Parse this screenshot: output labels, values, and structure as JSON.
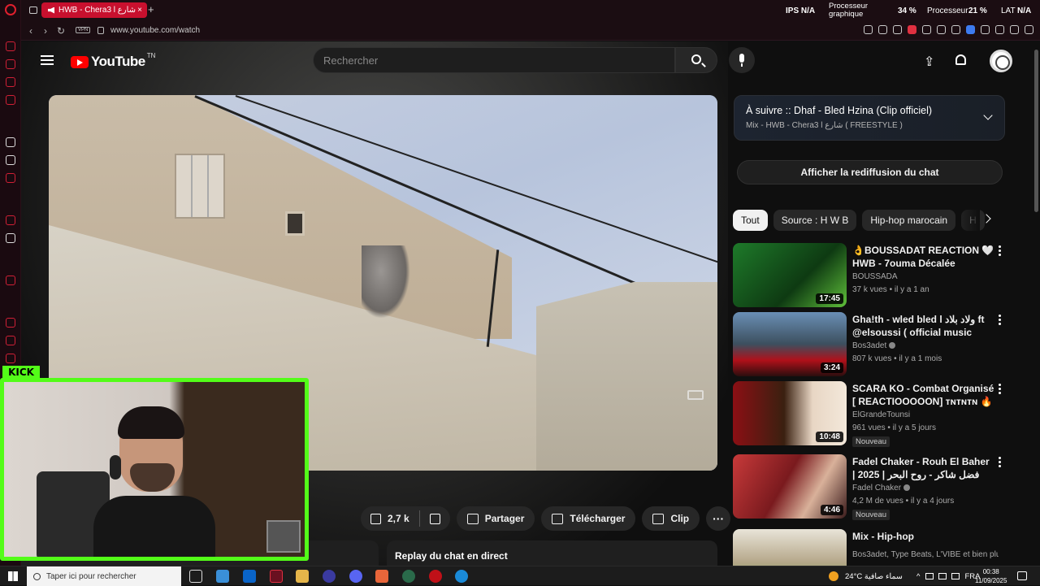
{
  "browser": {
    "tab_title": "HWB - Chera3 l شارع",
    "url": "www.youtube.com/watch",
    "vpn_label": "VPN",
    "hud": {
      "ips_label": "IPS",
      "ips_value": "N/A",
      "gpu_label_line1": "Processeur",
      "gpu_label_line2": "graphique",
      "gpu_value": "34 %",
      "cpu_label": "Processeur",
      "cpu_value": "21 %",
      "lat_label": "LAT",
      "lat_value": "N/A"
    }
  },
  "youtube": {
    "logo_text": "YouTube",
    "logo_country": "TN",
    "search_placeholder": "Rechercher",
    "actions": {
      "likes": "2,7 k",
      "share": "Partager",
      "download": "Télécharger",
      "clip": "Clip",
      "more": "···"
    },
    "replay_chat_label": "Replay du chat en direct",
    "up_next": {
      "title": "À suivre :: Dhaf - Bled Hzina (Clip officiel)",
      "subtitle": "Mix - HWB - Chera3 l شارع ( FREESTYLE )"
    },
    "show_chat_replay": "Afficher la rediffusion du chat",
    "chips": [
      "Tout",
      "Source : H W B",
      "Hip-hop marocain",
      "H"
    ],
    "recommendations": [
      {
        "title": "👌BOUSSADAT REACTION 🤍 HWB - 7ouma Décalée",
        "channel": "BOUSSADA",
        "verified": false,
        "meta": "37 k vues • il y a 1 an",
        "duration": "17:45",
        "badge": ""
      },
      {
        "title": "Gha!th - wled bled l ولاد بلاد ft @elsoussi ( official music vid...",
        "channel": "Bos3adet",
        "verified": true,
        "meta": "807 k vues • il y a 1 mois",
        "duration": "3:24",
        "badge": ""
      },
      {
        "title": "SCARA KO - Combat Organisé [ REACTIOOOOON] ᴛɴᴛɴᴛɴ 🔥🔥...",
        "channel": "ElGrandeTounsi",
        "verified": false,
        "meta": "961 vues • il y a 5 jours",
        "duration": "10:48",
        "badge": "Nouveau"
      },
      {
        "title": "Fadel Chaker - Rouh El Baher | فضل شاكر - روح البحر | 2025",
        "channel": "Fadel Chaker",
        "verified": true,
        "meta": "4,2 M de vues • il y a 4 jours",
        "duration": "4:46",
        "badge": "Nouveau"
      },
      {
        "title": "Mix - Hip-hop",
        "channel": "Bos3adet, Type Beats, L'VIBE et bien plu...",
        "verified": false,
        "meta": "",
        "duration": "",
        "badge": ""
      }
    ]
  },
  "overlay": {
    "kick_label": "KICK"
  },
  "taskbar": {
    "search_placeholder": "Taper ici pour rechercher",
    "weather": "24°C  سماء صافية",
    "lang": "FRA",
    "time": "00:38",
    "date": "11/09/2025"
  },
  "colors": {
    "kick_green": "#53fc18",
    "opera_red": "#c8102e",
    "yt_red": "#ff0000"
  }
}
